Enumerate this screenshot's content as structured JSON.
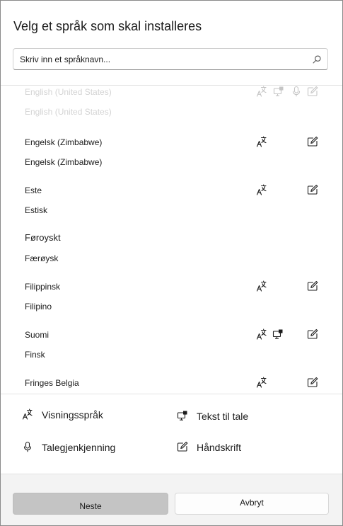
{
  "dialog": {
    "title": "Velg et språk som skal installeres",
    "search": {
      "placeholder": "Skriv inn et språknavn...",
      "value": "",
      "icon": "search-icon"
    }
  },
  "languages": [
    {
      "native": "English (United States)",
      "local": "English (United States)",
      "faded": true,
      "features": [
        "display-language",
        "text-to-speech",
        "speech-recognition",
        "handwriting"
      ]
    },
    {
      "native": "Engelsk (Zimbabwe)",
      "local": "Engelsk (Zimbabwe)",
      "faded": false,
      "features": [
        "display-language",
        "handwriting"
      ]
    },
    {
      "native": "Este",
      "local": "Estisk",
      "faded": false,
      "features": [
        "display-language",
        "handwriting"
      ]
    },
    {
      "native": "Føroyskt",
      "local": "Færøysk",
      "faded": false,
      "features": []
    },
    {
      "native": "Filippinsk",
      "local": "Filipino",
      "faded": false,
      "features": [
        "display-language",
        "handwriting"
      ]
    },
    {
      "native": "Suomi",
      "local": "Finsk",
      "faded": false,
      "features": [
        "display-language",
        "text-to-speech",
        "handwriting"
      ]
    },
    {
      "native": "Fringes Belgia",
      "local": "",
      "faded": false,
      "features": [
        "display-language",
        "handwriting"
      ]
    }
  ],
  "legend": {
    "display_language": "Visningsspråk",
    "text_to_speech": "Tekst til tale",
    "speech_recognition": "Talegjenkjenning",
    "handwriting": "Håndskrift"
  },
  "buttons": {
    "next": "Neste",
    "cancel": "Avbryt"
  },
  "colors": {
    "text": "#1b1b1b",
    "faded_text": "#d4d4d4",
    "footer_bg": "#f3f3f3",
    "next_bg": "#c4c4c4"
  }
}
